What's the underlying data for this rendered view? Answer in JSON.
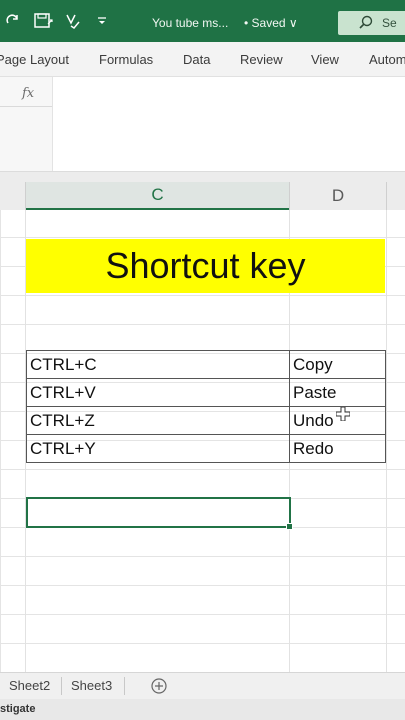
{
  "titlebar": {
    "doc_title": "You tube ms...",
    "saved_status": "• Saved ∨",
    "search_placeholder": "Se",
    "accent_color": "#1f7245"
  },
  "ribbon": {
    "tabs": [
      "Page Layout",
      "Formulas",
      "Data",
      "Review",
      "View",
      "Autom"
    ]
  },
  "formula_bar": {
    "fx_label": "fx",
    "value": ""
  },
  "columns": [
    "C",
    "D"
  ],
  "title_cell": {
    "text": "Shortcut key",
    "fill_color": "#ffff00"
  },
  "shortcuts": [
    {
      "key": "CTRL+C",
      "action": "Copy"
    },
    {
      "key": "CTRL+V",
      "action": "Paste"
    },
    {
      "key": "CTRL+Z",
      "action": "Undo"
    },
    {
      "key": "CTRL+Y",
      "action": "Redo"
    }
  ],
  "sheets": [
    "Sheet2",
    "Sheet3"
  ],
  "status": {
    "text": "stigate"
  }
}
